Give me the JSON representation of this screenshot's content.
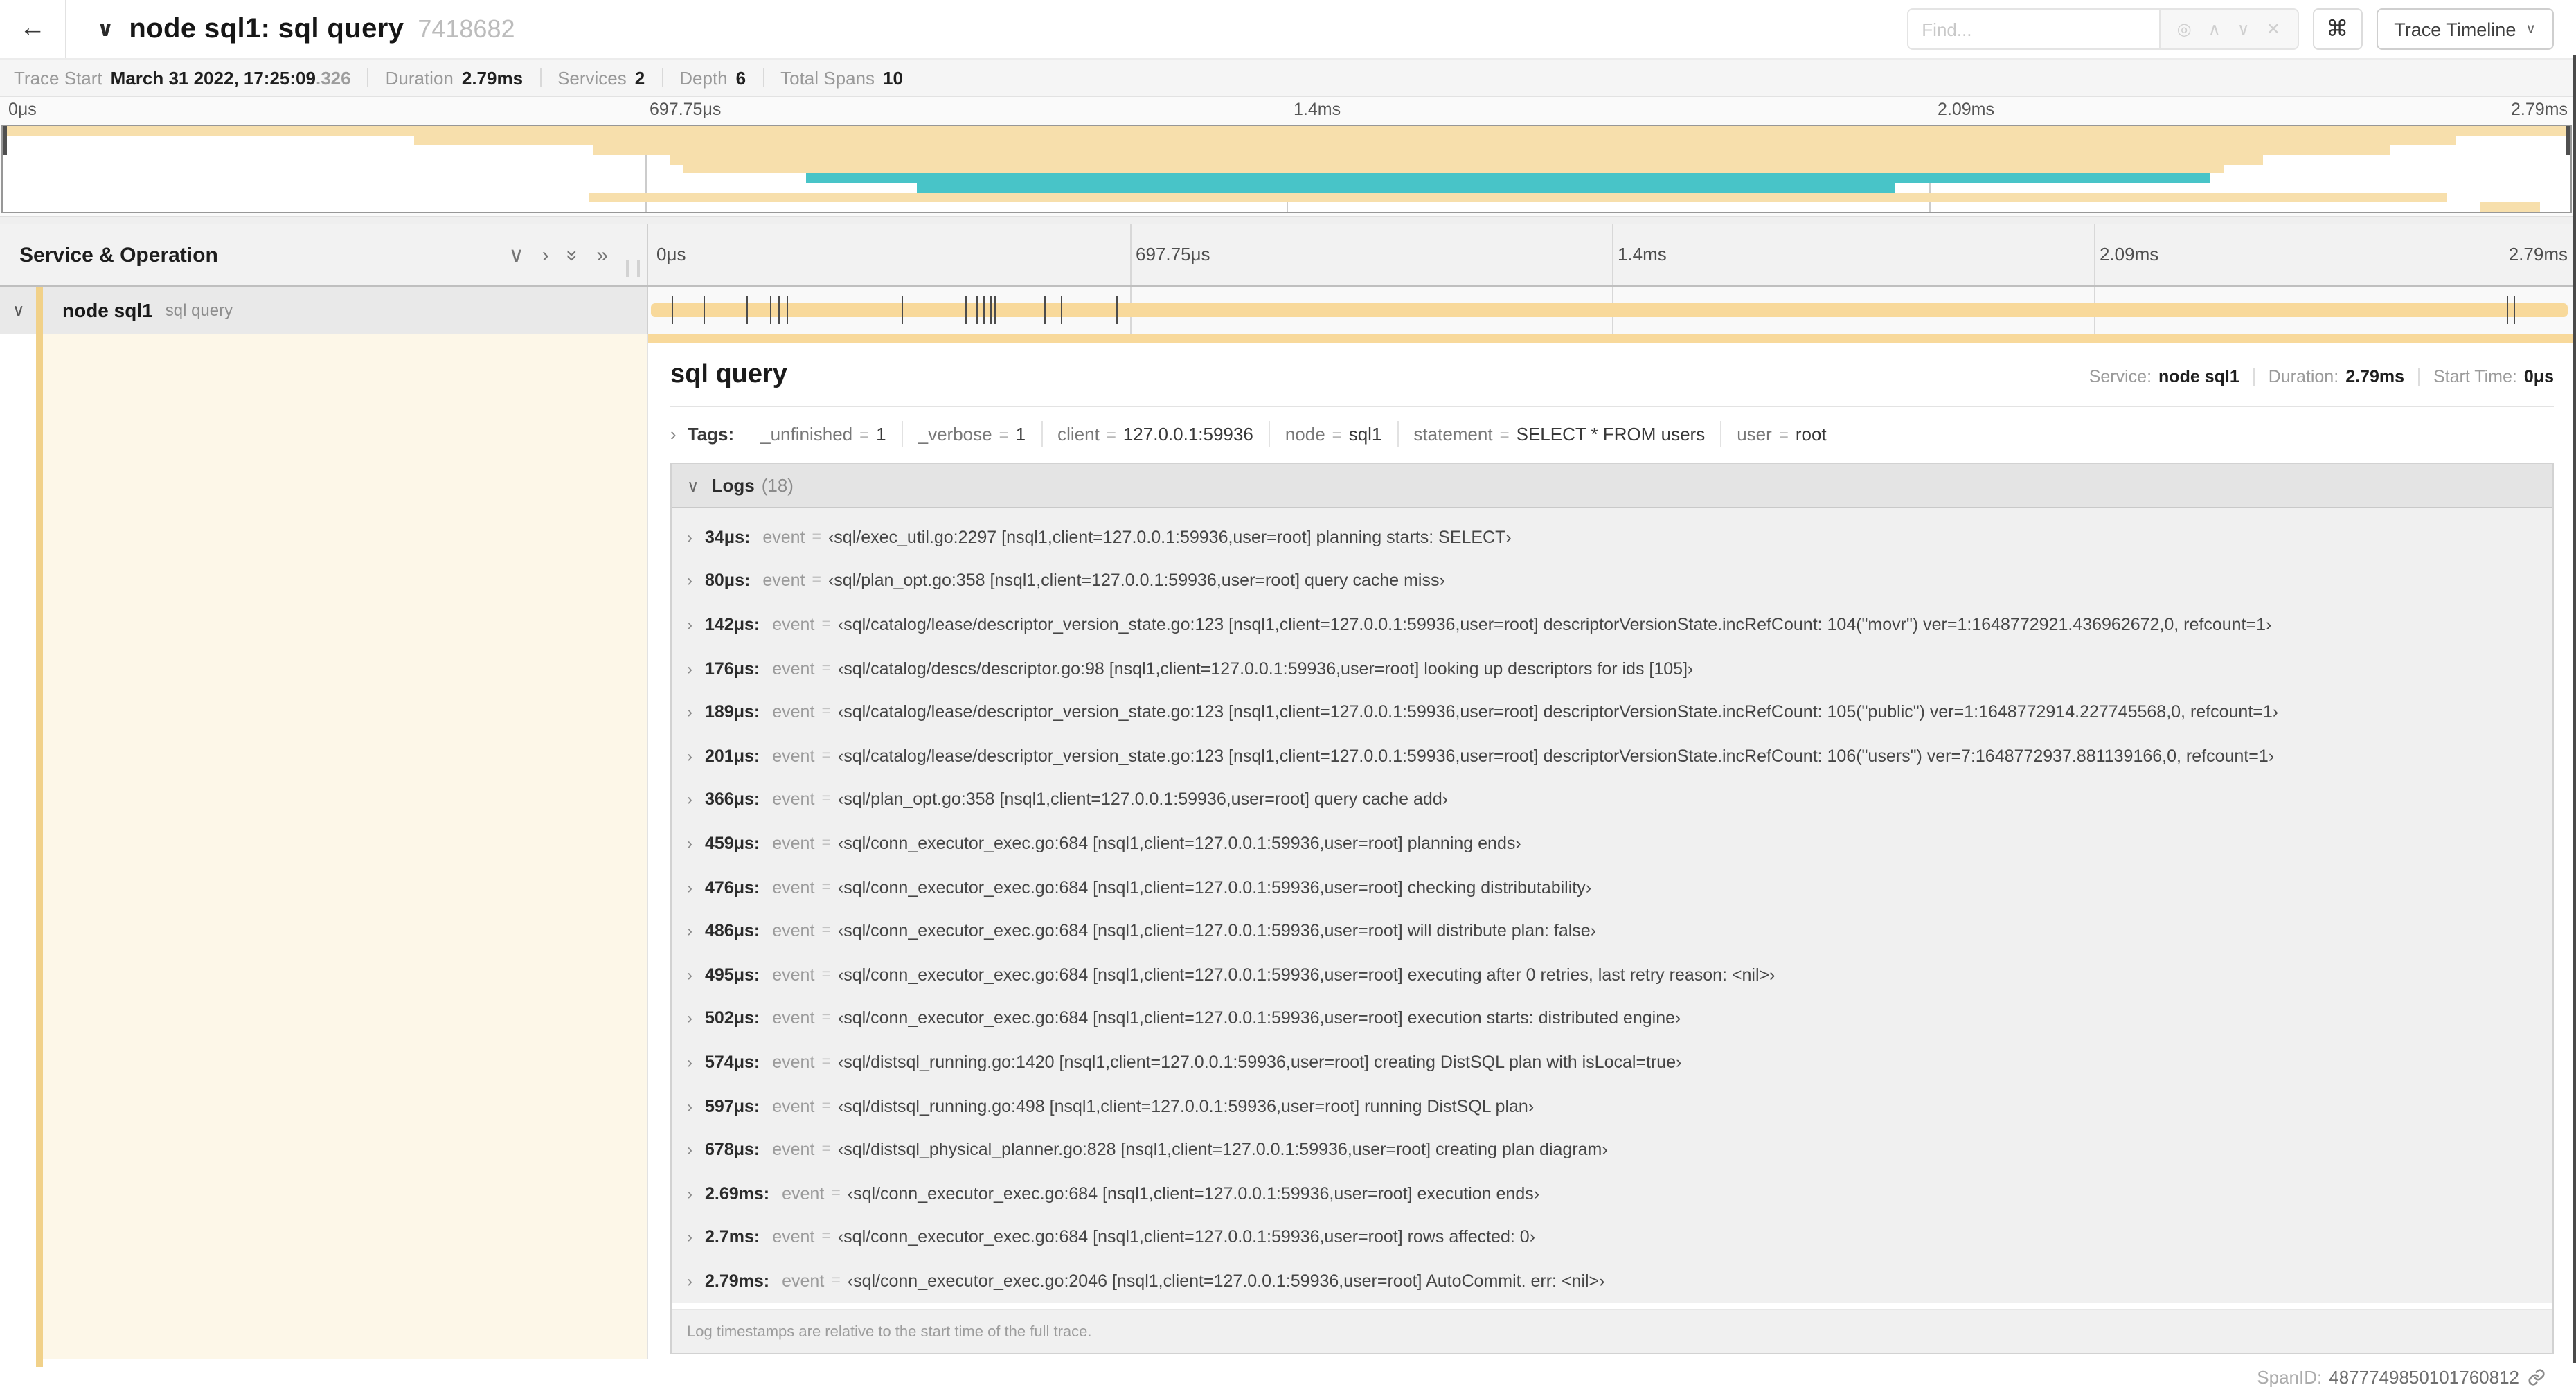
{
  "colors": {
    "tan_bar": "#F8D99B",
    "tan_minimap": "#F7DFAC",
    "tan_stripe": "#F1D189",
    "teal": "#48C4C8",
    "cream": "#FDF7E8"
  },
  "header": {
    "back_icon": "left-arrow",
    "collapse_icon": "chevron-down",
    "title": "node sql1: sql query",
    "trace_id_short": "7418682",
    "find_placeholder": "Find...",
    "keyboard_shortcut_icon": "⌘",
    "view_selector_label": "Trace Timeline"
  },
  "stats": [
    {
      "label": "Trace Start",
      "value": "March 31 2022, 17:25:09",
      "suffix": ".326"
    },
    {
      "label": "Duration",
      "value": "2.79ms",
      "suffix": ""
    },
    {
      "label": "Services",
      "value": "2",
      "suffix": ""
    },
    {
      "label": "Depth",
      "value": "6",
      "suffix": ""
    },
    {
      "label": "Total Spans",
      "value": "10",
      "suffix": ""
    }
  ],
  "minimap": {
    "ruler_labels": [
      {
        "text": "0μs",
        "pos": 0
      },
      {
        "text": "697.75μs",
        "pos": 25
      },
      {
        "text": "1.4ms",
        "pos": 50
      },
      {
        "text": "2.09ms",
        "pos": 75
      },
      {
        "text": "2.79ms",
        "pos": 100
      }
    ],
    "bars": [
      {
        "start": 0,
        "end": 100,
        "color": "tan"
      },
      {
        "start": 16,
        "end": 95.5,
        "color": "tan"
      },
      {
        "start": 23,
        "end": 93,
        "color": "tan"
      },
      {
        "start": 26,
        "end": 88,
        "color": "tan"
      },
      {
        "start": 26.5,
        "end": 86.5,
        "color": "tan"
      },
      {
        "start": 31.3,
        "end": 86,
        "color": "teal"
      },
      {
        "start": 35.6,
        "end": 73.7,
        "color": "teal"
      },
      {
        "start": 22.8,
        "end": 95.2,
        "color": "tan"
      },
      {
        "start": 96.5,
        "end": 98.8,
        "color": "tan"
      }
    ]
  },
  "timeline": {
    "columns_header": "Service & Operation",
    "ruler_labels": [
      {
        "text": "0μs",
        "pos": 0
      },
      {
        "text": "697.75μs",
        "pos": 25
      },
      {
        "text": "1.4ms",
        "pos": 50
      },
      {
        "text": "2.09ms",
        "pos": 75
      },
      {
        "text": "2.79ms",
        "pos": 100
      }
    ],
    "duration_us": 2790,
    "row": {
      "service": "node sql1",
      "operation": "sql query"
    }
  },
  "detail": {
    "title": "sql query",
    "meta": [
      {
        "label": "Service:",
        "value": "node sql1"
      },
      {
        "label": "Duration:",
        "value": "2.79ms"
      },
      {
        "label": "Start Time:",
        "value": "0μs"
      }
    ],
    "tags_label": "Tags:",
    "tags": [
      {
        "key": "_unfinished",
        "value": "1"
      },
      {
        "key": "_verbose",
        "value": "1"
      },
      {
        "key": "client",
        "value": "127.0.0.1:59936"
      },
      {
        "key": "node",
        "value": "sql1"
      },
      {
        "key": "statement",
        "value": "SELECT * FROM users"
      },
      {
        "key": "user",
        "value": "root"
      }
    ],
    "logs_label": "Logs",
    "logs_count": "(18)",
    "logs": [
      {
        "t": "34μs:",
        "t_us": 34,
        "key": "event",
        "value": "‹sql/exec_util.go:2297 [nsql1,client=127.0.0.1:59936,user=root] planning starts: SELECT›"
      },
      {
        "t": "80μs:",
        "t_us": 80,
        "key": "event",
        "value": "‹sql/plan_opt.go:358 [nsql1,client=127.0.0.1:59936,user=root] query cache miss›"
      },
      {
        "t": "142μs:",
        "t_us": 142,
        "key": "event",
        "value": "‹sql/catalog/lease/descriptor_version_state.go:123 [nsql1,client=127.0.0.1:59936,user=root] descriptorVersionState.incRefCount: 104(\"movr\") ver=1:1648772921.436962672,0, refcount=1›"
      },
      {
        "t": "176μs:",
        "t_us": 176,
        "key": "event",
        "value": "‹sql/catalog/descs/descriptor.go:98 [nsql1,client=127.0.0.1:59936,user=root] looking up descriptors for ids [105]›"
      },
      {
        "t": "189μs:",
        "t_us": 189,
        "key": "event",
        "value": "‹sql/catalog/lease/descriptor_version_state.go:123 [nsql1,client=127.0.0.1:59936,user=root] descriptorVersionState.incRefCount: 105(\"public\") ver=1:1648772914.227745568,0, refcount=1›"
      },
      {
        "t": "201μs:",
        "t_us": 201,
        "key": "event",
        "value": "‹sql/catalog/lease/descriptor_version_state.go:123 [nsql1,client=127.0.0.1:59936,user=root] descriptorVersionState.incRefCount: 106(\"users\") ver=7:1648772937.881139166,0, refcount=1›"
      },
      {
        "t": "366μs:",
        "t_us": 366,
        "key": "event",
        "value": "‹sql/plan_opt.go:358 [nsql1,client=127.0.0.1:59936,user=root] query cache add›"
      },
      {
        "t": "459μs:",
        "t_us": 459,
        "key": "event",
        "value": "‹sql/conn_executor_exec.go:684 [nsql1,client=127.0.0.1:59936,user=root] planning ends›"
      },
      {
        "t": "476μs:",
        "t_us": 476,
        "key": "event",
        "value": "‹sql/conn_executor_exec.go:684 [nsql1,client=127.0.0.1:59936,user=root] checking distributability›"
      },
      {
        "t": "486μs:",
        "t_us": 486,
        "key": "event",
        "value": "‹sql/conn_executor_exec.go:684 [nsql1,client=127.0.0.1:59936,user=root] will distribute plan: false›"
      },
      {
        "t": "495μs:",
        "t_us": 495,
        "key": "event",
        "value": "‹sql/conn_executor_exec.go:684 [nsql1,client=127.0.0.1:59936,user=root] executing after 0 retries, last retry reason: <nil>›"
      },
      {
        "t": "502μs:",
        "t_us": 502,
        "key": "event",
        "value": "‹sql/conn_executor_exec.go:684 [nsql1,client=127.0.0.1:59936,user=root] execution starts: distributed engine›"
      },
      {
        "t": "574μs:",
        "t_us": 574,
        "key": "event",
        "value": "‹sql/distsql_running.go:1420 [nsql1,client=127.0.0.1:59936,user=root] creating DistSQL plan with isLocal=true›"
      },
      {
        "t": "597μs:",
        "t_us": 597,
        "key": "event",
        "value": "‹sql/distsql_running.go:498 [nsql1,client=127.0.0.1:59936,user=root] running DistSQL plan›"
      },
      {
        "t": "678μs:",
        "t_us": 678,
        "key": "event",
        "value": "‹sql/distsql_physical_planner.go:828 [nsql1,client=127.0.0.1:59936,user=root] creating plan diagram›"
      },
      {
        "t": "2.69ms:",
        "t_us": 2690,
        "key": "event",
        "value": "‹sql/conn_executor_exec.go:684 [nsql1,client=127.0.0.1:59936,user=root] execution ends›"
      },
      {
        "t": "2.7ms:",
        "t_us": 2700,
        "key": "event",
        "value": "‹sql/conn_executor_exec.go:684 [nsql1,client=127.0.0.1:59936,user=root] rows affected: 0›"
      },
      {
        "t": "2.79ms:",
        "t_us": 2790,
        "key": "event",
        "value": "‹sql/conn_executor_exec.go:2046 [nsql1,client=127.0.0.1:59936,user=root] AutoCommit. err: <nil>›"
      }
    ],
    "footnote": "Log timestamps are relative to the start time of the full trace.",
    "spanid_label": "SpanID:",
    "spanid": "4877749850101760812"
  }
}
